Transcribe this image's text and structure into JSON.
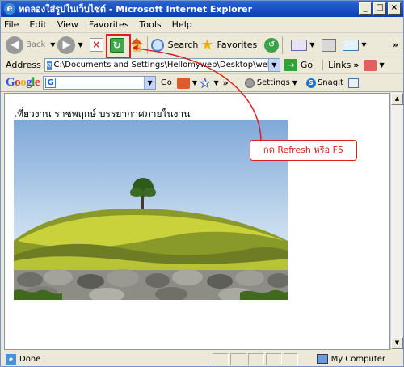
{
  "window": {
    "title": "ทดลองใส่รูปในเว็บไซต์ - Microsoft Internet Explorer",
    "buttons": [
      "minimize",
      "maximize",
      "close"
    ]
  },
  "menu": [
    "File",
    "Edit",
    "View",
    "Favorites",
    "Tools",
    "Help"
  ],
  "toolbar": {
    "back_label": "Back",
    "search_label": "Search",
    "favorites_label": "Favorites"
  },
  "address": {
    "label": "Address",
    "value": "C:\\Documents and Settings\\Hellomyweb\\Desktop\\web\\index.html",
    "go_label": "Go",
    "links_label": "Links"
  },
  "google": {
    "logo": "Google",
    "search_value": "",
    "go_label": "Go",
    "settings_label": "Settings",
    "snagit_label": "SnagIt"
  },
  "page": {
    "heading": "เที่ยวงาน ราชพฤกษ์ บรรยากาศภายในงาน"
  },
  "annotation": {
    "text": "กด Refresh หรือ F5",
    "color": "#d92020"
  },
  "status": {
    "text": "Done",
    "zone": "My Computer"
  }
}
